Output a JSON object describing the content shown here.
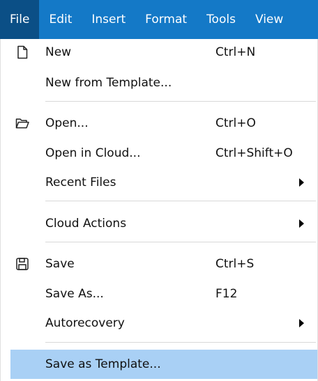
{
  "menubar": {
    "items": [
      {
        "label": "File"
      },
      {
        "label": "Edit"
      },
      {
        "label": "Insert"
      },
      {
        "label": "Format"
      },
      {
        "label": "Tools"
      },
      {
        "label": "View"
      }
    ]
  },
  "file_menu": {
    "items": [
      {
        "label": "New",
        "shortcut": "Ctrl+N",
        "icon": "new-document-icon"
      },
      {
        "label": "New from Template..."
      },
      {
        "label": "Open...",
        "shortcut": "Ctrl+O",
        "icon": "open-folder-icon"
      },
      {
        "label": "Open in Cloud...",
        "shortcut": "Ctrl+Shift+O"
      },
      {
        "label": "Recent Files",
        "submenu": true
      },
      {
        "label": "Cloud Actions",
        "submenu": true
      },
      {
        "label": "Save",
        "shortcut": "Ctrl+S",
        "icon": "save-floppy-icon"
      },
      {
        "label": "Save As...",
        "shortcut": "F12"
      },
      {
        "label": "Autorecovery",
        "submenu": true
      },
      {
        "label": "Save as Template...",
        "highlighted": true
      }
    ]
  },
  "colors": {
    "menubar_bg": "#1479c7",
    "menubar_active": "#0b4f86",
    "highlight": "#a9d0f5"
  }
}
